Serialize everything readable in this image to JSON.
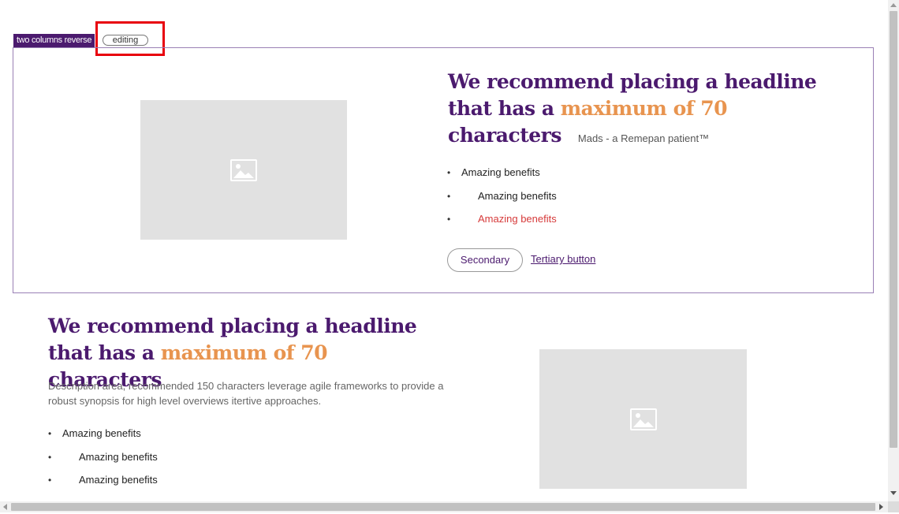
{
  "component": {
    "label": "two columns reverse",
    "status": "editing"
  },
  "section_top": {
    "headline_start": "We recommend placing a headline that has a ",
    "headline_accent": "maximum of 70",
    "headline_end": " characters",
    "attribution": "Mads - a Remepan patient™",
    "benefits": [
      "Amazing benefits",
      "Amazing benefits",
      "Amazing benefits"
    ],
    "secondary_button": "Secondary",
    "tertiary_button": "Tertiary button",
    "image_icon": "image-placeholder-icon"
  },
  "section_bottom": {
    "headline_start": "We recommend placing a headline that has a ",
    "headline_accent": "maximum of 70",
    "headline_end": " characters",
    "description": "Description area, recommended 150 characters leverage agile frameworks to provide a robust synopsis for high level overviews itertive approaches.",
    "benefits": [
      "Amazing benefits",
      "Amazing benefits",
      "Amazing benefits"
    ],
    "image_icon": "image-placeholder-icon"
  },
  "colors": {
    "brand_purple": "#4b1a6e",
    "accent_orange": "#e8944f",
    "highlight_red": "#e8000d",
    "error_red": "#d63a3a",
    "placeholder_gray": "#e1e1e1"
  }
}
